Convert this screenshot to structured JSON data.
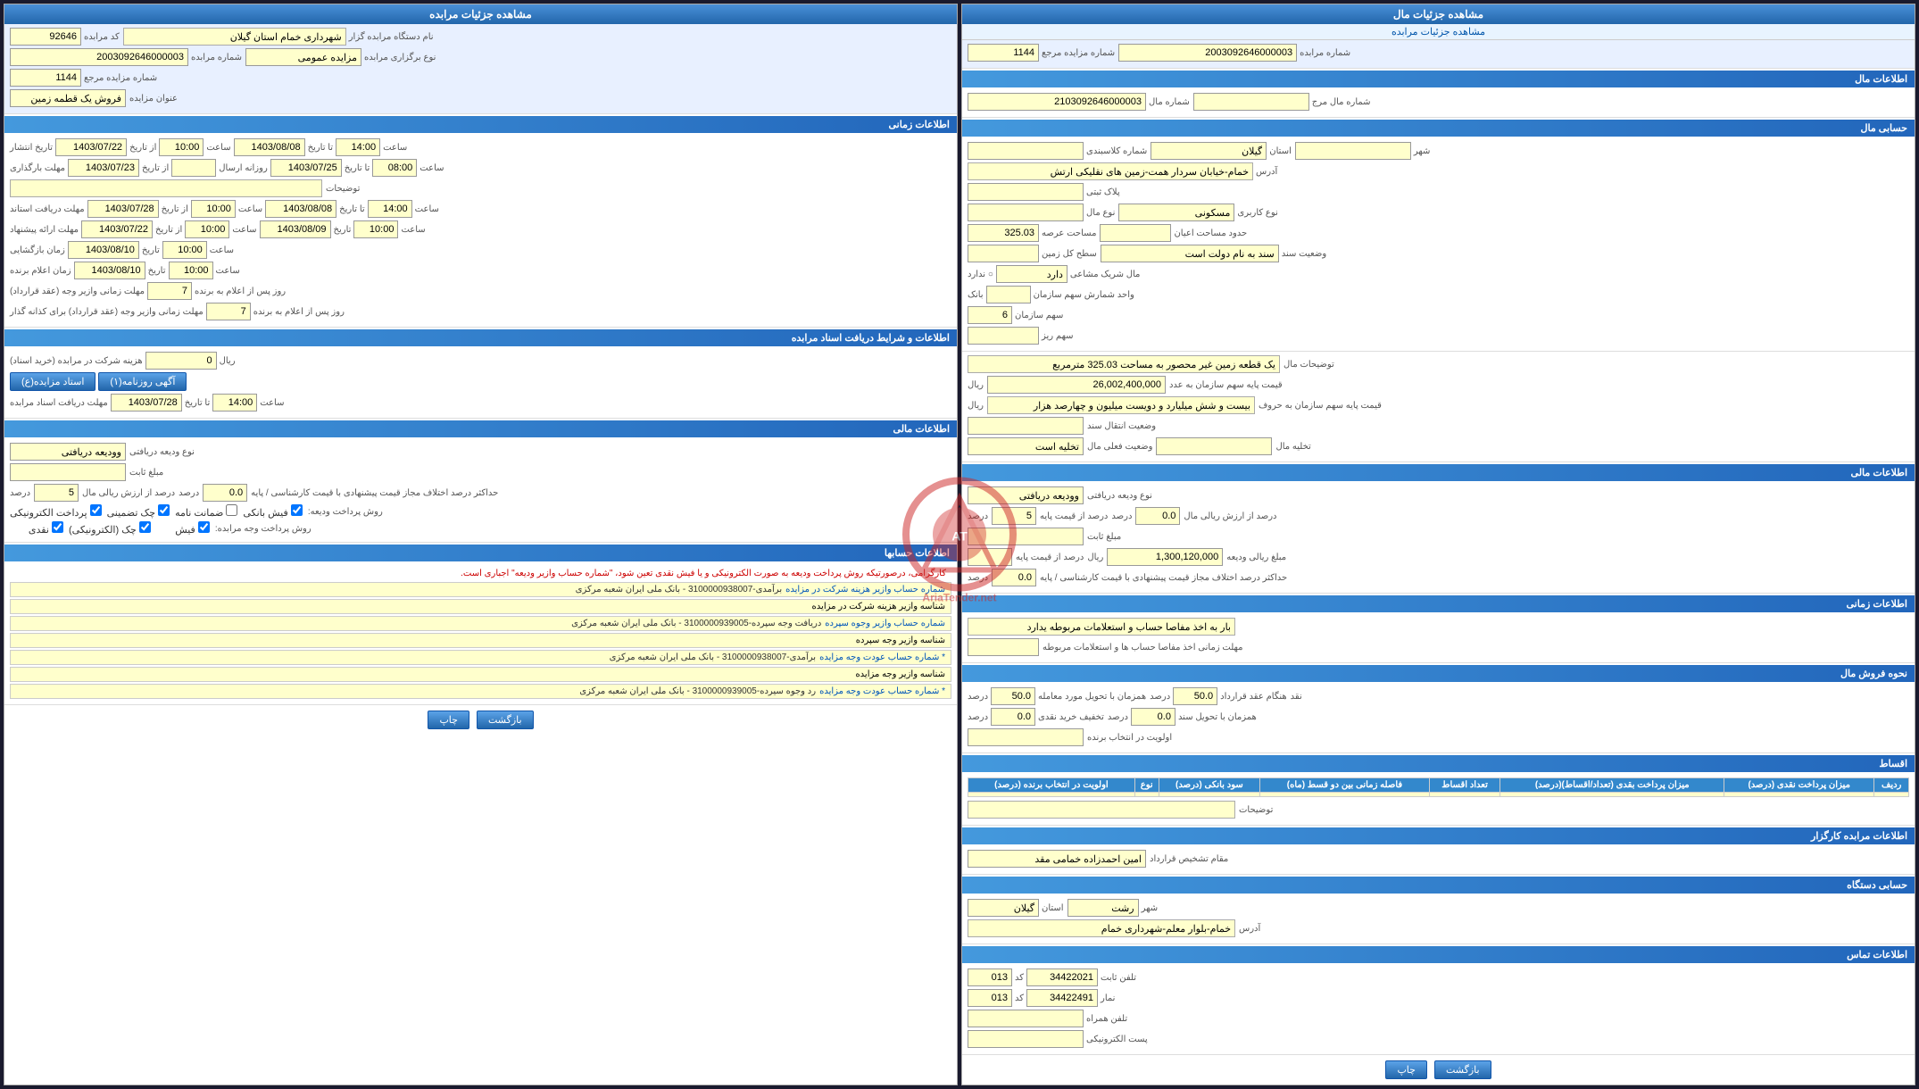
{
  "leftPanel": {
    "mainHeader": "مشاهده جزئیات مال",
    "linkText": "مشاهده جزئیات مرابده",
    "fields": {
      "shomareMorabedeMarje": "1144",
      "shomareMorabede": "2003092646000003"
    },
    "malInfo": {
      "header": "اطلاعات مال",
      "shomareMal": "2103092646000003",
      "shomareMalMarje": "",
      "hasabiMal": {
        "header": "حسابی مال",
        "ostan": "گیلان",
        "shahr": "",
        "adres": "خمام-خیابان سردار همت-زمین های نقلیکی ارتش",
        "plakSabti": "",
        "noeKarbari": "مسکونی",
        "hodoodeMasahe": "",
        "vaziatSanad": "سند به نام دولت است",
        "vahidShareshi": "بانک",
        "sahmeSazman": "6",
        "sahmRiz": ""
      }
    },
    "tazihMal": "یک قطعه زمین غیر محصور به مساحت 325.03 مترمربع",
    "qimatBase": "26,002,400,000",
    "qimatBaseText": "بیست و شش میلیارد و دویست میلیون و چهارصد هزار",
    "vaziatEnteghal": "",
    "vaziatFelliMal": "تخلیه است",
    "takhlieMal": "",
    "malInfo2": {
      "header": "اطلاعات مالی",
      "noeVadieh": "وودیعه دریافتی",
      "mablaghSabet": "",
      "darSadAzQimat": "5",
      "darSadAzArzesh": "0.0"
    },
    "zamanInfo": {
      "header": "اطلاعات زمانی",
      "siarBarAkhezHesab": "بار به اخذ مفاصا حساب و استعلامات مربوطه یدارد",
      "mohlat": ""
    },
    "nohveForush": {
      "header": "نحوه فروش مال",
      "naghdPercent1": "50.0",
      "naghdPercent2": "50.0",
      "hamzamanPercent": "50.0",
      "tahvilSanad": "0.0",
      "takhfifKharid": "0.0",
      "ologyatDarEntekhabBagende": ""
    },
    "aghsat": {
      "header": "اقساط"
    },
    "morabedeKarbar": {
      "header": "اطلاعات مرابده کارگزار",
      "maghameEntekhabKarfarma": "امین احمدزاده خمامی مقد",
      "hasabiDastgah": {
        "header": "حسابی دستگاه",
        "ostan": "گیلان",
        "shahr": "رشت",
        "adres": "خمام-بلوار معلم-شهرداری خمام"
      },
      "ettelaatTemase": {
        "header": "اطلاعات تماس",
        "telefonSabet": "34422021",
        "telefonSabetCode": "013",
        "namar": "34422491",
        "namarCode": "013",
        "telefonHamrah": "",
        "posteElectroniki": ""
      }
    },
    "buttons": {
      "chap": "چاپ",
      "bazgasht": "بازگشت"
    }
  },
  "rightPanel": {
    "mainHeader": "مشاهده جزئیات مرابده",
    "fields": {
      "kodMorabede": "92646",
      "shomareMorabede": "2003092646000003",
      "shomareMorabedeMarje": "1144",
      "onvanMorabede": "فروش یک قطمه زمین",
      "namDastgah": "شهرداری خمام استان گیلان",
      "noeBargarzan": "مزایده عمومی"
    },
    "zamanInfo": {
      "header": "اطلاعات زمانی",
      "tarikhEnteshar": "1403/07/22",
      "saatEnteshar": "10:00",
      "tarikhPayan": "1403/08/08",
      "saatPayan": "14:00",
      "tarikhMohlat": "1403/07/23",
      "saatMohlat": "",
      "tarikhMohlatPayan": "1403/07/25",
      "saatMohlatPayan": "08:00",
      "rozaneArze": "روزانه ارسال",
      "mohlat2From": "1403/07/28",
      "mohlat2To": "1403/08/08",
      "saatMohlat2From": "10:00",
      "saatMohlat2To": "14:00",
      "tarikhEraePishnahad": "1403/07/22",
      "saatEraePishnahad": "10:00",
      "tarikhEraePishnahahdPayan": "1403/08/09",
      "saatEraePishnahahdPayan": "10:00",
      "zamanBazgoshaii": "1403/08/10",
      "saatBazgoshaii": "10:00",
      "zamanEelamBerende": "1403/08/10",
      "saatEelamBerende": "10:00",
      "mohlatZamaniVazirBerende": "7",
      "mohlatZamaniVazirKhazaneDar": "7"
    },
    "asnadInfo": {
      "header": "اطلاعات و شرایط دریافت اسناد مرابده",
      "ostadMorabede": "استاد مزایده(ع)",
      "agahiRoozname": "آگهی روزنامه(۱)",
      "hazineSherkot": "0",
      "mohlatDaryaftAsnad": "1403/07/28",
      "saatMohlatDaryaft": "14:00"
    },
    "maliInfo": {
      "header": "اطلاعات مالی",
      "noeVadieh": "وودیعه دریافتی",
      "mablaghSabet": "",
      "darSadAzQimat": "5",
      "darSadAzArzesh": "0.0",
      "nohvePayment": {
        "electroniki": true,
        "chekTazmin": true,
        "zamanat": false,
        "fisch": true
      },
      "nohvePaymentVojh": {
        "naghd": true,
        "electroniki": true,
        "chek": true,
        "fisch": true
      }
    },
    "hesabha": {
      "header": "اطلاعات حسابها",
      "infoText": "کارگرامی، درصورتیکه روش پرداخت ودیعه به صورت الکترونیکی و یا فیش نقدی تعین شود، \"شماره حساب وازیر ودیعه\" اجباری است.",
      "accounts": [
        {
          "label": "شماره حساب وازیر هزینه شرکت در مزایده",
          "bank": "بانک ملی ایران شعبه مرکزی",
          "account": "برآمدی-3100000938007"
        },
        {
          "label": "شناسه وازیر هزینه شرکت در مزایده",
          "bank": "",
          "account": ""
        },
        {
          "label": "شماره حساب وازیر وجوه سپرده",
          "bank": "بانک ملی ایران شعبه مرکزی",
          "account": "دریافت وجه سپرده-3100000939005"
        },
        {
          "label": "شناسه وازیر وجه سپرده",
          "bank": "",
          "account": ""
        },
        {
          "label": "شماره حساب عودت وجه مزایده",
          "bank": "بانک ملی ایران شعبه مرکزی",
          "account": "برآمدی-3100000938007"
        },
        {
          "label": "شناسه وازیر وجه مزایده",
          "bank": "",
          "account": ""
        },
        {
          "label": "شماره حساب عودت وجه مزایده",
          "bank": "بانک ملی ایران شعبه مرکزی",
          "account": "رد وجوه سیرده-3100000939005"
        }
      ]
    },
    "buttons": {
      "chap": "چاپ",
      "bazgasht": "بازگشت"
    }
  }
}
